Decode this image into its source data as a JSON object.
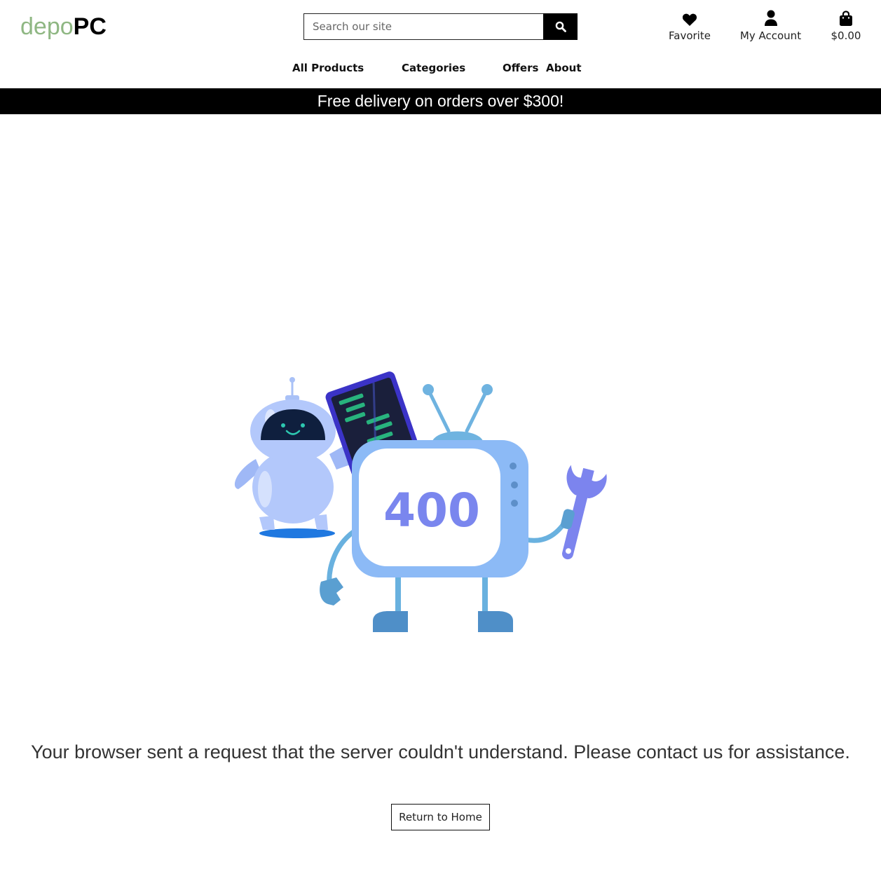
{
  "header": {
    "logo_part1": "depo",
    "logo_part2": "PC",
    "search_placeholder": "Search our site",
    "search_button_icon": "search-icon",
    "favorite_label": "Favorite",
    "favorite_icon": "heart-icon",
    "account_label": "My Account",
    "account_icon": "user-icon",
    "cart_total": "$0.00",
    "cart_icon": "shopping-bag-icon"
  },
  "nav": {
    "items": [
      {
        "label": "All Products"
      },
      {
        "label": "Categories"
      },
      {
        "label": "Offers"
      },
      {
        "label": "About"
      }
    ]
  },
  "banner": {
    "text": "Free delivery on orders over $300!"
  },
  "error": {
    "code": "400",
    "message": "Your browser sent a request that the server couldn't understand. Please contact us for assistance.",
    "button_label": "Return to Home"
  },
  "colors": {
    "logo_light": "#8fb783",
    "logo_dark": "#000000",
    "banner_bg": "#000000",
    "banner_text": "#ffffff",
    "illustration_blue": "#8db8f5",
    "illustration_code": "#7c7ff0"
  }
}
